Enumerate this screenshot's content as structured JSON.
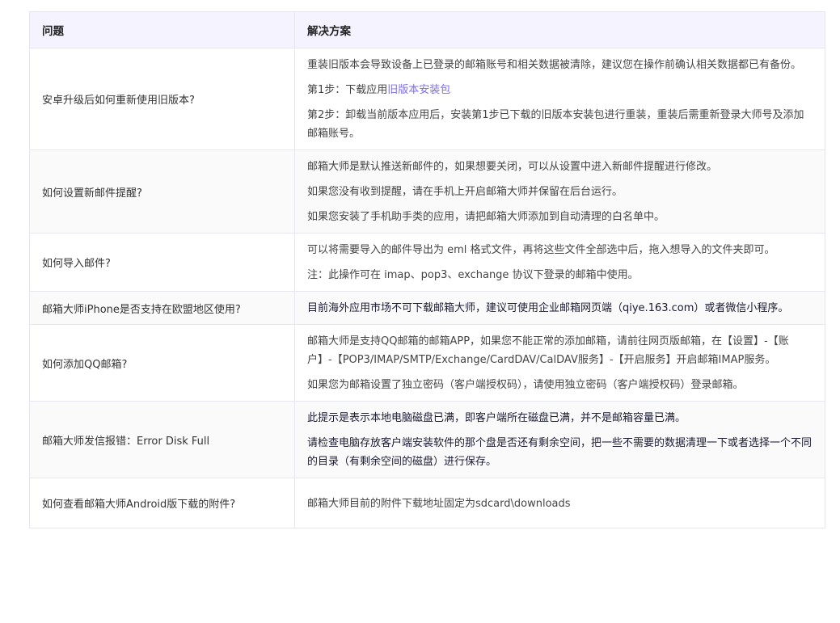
{
  "table": {
    "headers": {
      "question": "问题",
      "solution": "解决方案"
    },
    "rows": [
      {
        "question": "安卓升级后如何重新使用旧版本?",
        "answers": [
          "重装旧版本会导致设备上已登录的邮箱账号和相关数据被清除，建议您在操作前确认相关数据都已有备份。"
        ],
        "step1_prefix": "第1步：下载应用",
        "step1_link": "旧版本安装包",
        "step2": "第2步：卸载当前版本应用后，安装第1步已下载的旧版本安装包进行重装，重装后需重新登录大师号及添加邮箱账号。"
      },
      {
        "question": "如何设置新邮件提醒?",
        "answers": [
          "邮箱大师是默认推送新邮件的，如果想要关闭，可以从设置中进入新邮件提醒进行修改。",
          "如果您没有收到提醒，请在手机上开启邮箱大师并保留在后台运行。",
          "如果您安装了手机助手类的应用，请把邮箱大师添加到自动清理的白名单中。"
        ]
      },
      {
        "question": "如何导入邮件?",
        "answers": [
          "可以将需要导入的邮件导出为 eml 格式文件，再将这些文件全部选中后，拖入想导入的文件夹即可。",
          "注：此操作可在 imap、pop3、exchange 协议下登录的邮箱中使用。"
        ]
      },
      {
        "question": "邮箱大师iPhone是否支持在欧盟地区使用?",
        "answers": [
          "目前海外应用市场不可下载邮箱大师，建议可使用企业邮箱网页端（qiye.163.com）或者微信小程序。"
        ]
      },
      {
        "question": "如何添加QQ邮箱?",
        "answers": [
          "邮箱大师是支持QQ邮箱的邮箱APP，如果您不能正常的添加邮箱，请前往网页版邮箱，在【设置】-【账户】-【POP3/IMAP/SMTP/Exchange/CardDAV/CalDAV服务】-【开启服务】开启邮箱IMAP服务。",
          "如果您为邮箱设置了独立密码（客户端授权码），请使用独立密码（客户端授权码）登录邮箱。"
        ]
      },
      {
        "question": "邮箱大师发信报错：Error Disk Full",
        "answers": [
          "此提示是表示本地电脑磁盘已满，即客户端所在磁盘已满，并不是邮箱容量已满。",
          "请检查电脑存放客户端安装软件的那个盘是否还有剩余空间，把一些不需要的数据清理一下或者选择一个不同的目录（有剩余空间的磁盘）进行保存。"
        ]
      },
      {
        "question": "如何查看邮箱大师Android版下载的附件?",
        "answers": [
          "邮箱大师目前的附件下载地址固定为sdcard\\downloads"
        ]
      }
    ]
  }
}
